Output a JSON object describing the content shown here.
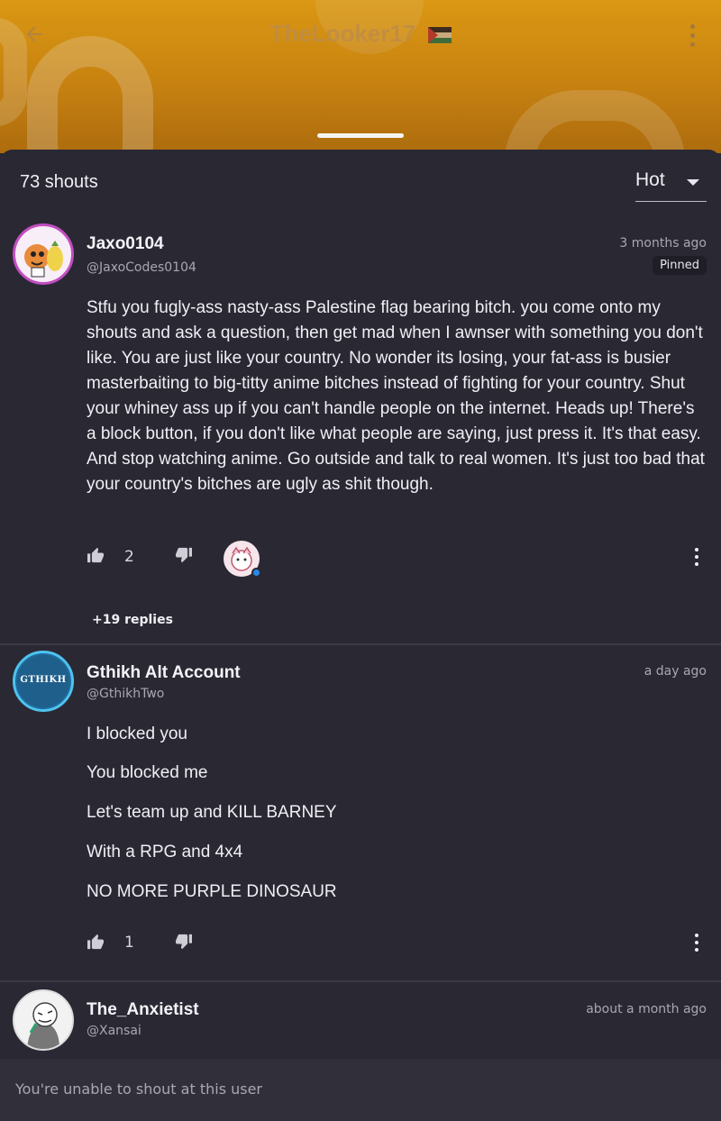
{
  "header": {
    "title": "TheLooker17",
    "flag_icon": "palestine-flag-icon",
    "back_icon": "arrow-left-icon",
    "more_icon": "more-vertical-icon",
    "banner_color": "#e8a215"
  },
  "shouts": {
    "count_label": "73 shouts",
    "sort_label": "Hot"
  },
  "posts": [
    {
      "name": "Jaxo0104",
      "handle": "@JaxoCodes0104",
      "time": "3 months ago",
      "pinned_label": "Pinned",
      "body": "Stfu you fugly-ass nasty-ass Palestine flag bearing bitch. you come onto my shouts and ask a question, then get mad when I awnser with something you don't like. You are just like your country. No wonder its losing, your fat-ass is busier masterbaiting to big-titty anime bitches instead of fighting for your country. Shut your whiney ass up if you can't handle people on the internet. Heads up! There's a block button, if you don't like what people are saying, just press it. It's that easy. And stop watching anime. Go outside and talk to real women. It's just too bad that your country's bitches are ugly as shit though.",
      "likes": "2",
      "replies_label": "+19 replies"
    },
    {
      "name": "Gthikh Alt Account",
      "handle": "@GthikhTwo",
      "avatar_text": "GTHIKH",
      "time": "a day ago",
      "lines": [
        "I blocked you",
        "You blocked me",
        "Let's team up and KILL BARNEY",
        "With a RPG and 4x4",
        "NO MORE PURPLE DINOSAUR"
      ],
      "likes": "1"
    },
    {
      "name": "The_Anxietist",
      "handle": "@Xansai",
      "time": "about a month ago"
    }
  ],
  "footer": {
    "notice": "You're unable to shout at this user"
  }
}
